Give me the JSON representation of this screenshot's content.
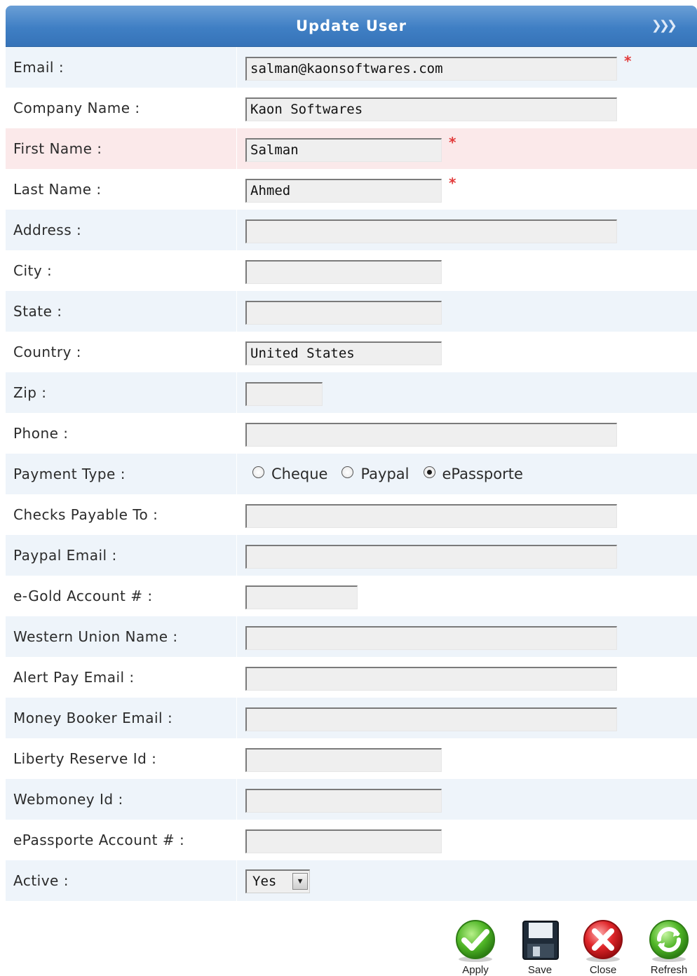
{
  "window": {
    "title": "Update User"
  },
  "fields": [
    {
      "label": "Email :",
      "value": "salman@kaonsoftwares.com",
      "width": "long",
      "required": true
    },
    {
      "label": "Company Name :",
      "value": "Kaon Softwares",
      "width": "long",
      "required": false
    },
    {
      "label": "First Name :",
      "value": "Salman",
      "width": "mid",
      "required": true
    },
    {
      "label": "Last Name :",
      "value": "Ahmed",
      "width": "mid",
      "required": true
    },
    {
      "label": "Address :",
      "value": "",
      "width": "long",
      "required": false
    },
    {
      "label": "City :",
      "value": "",
      "width": "mid",
      "required": false
    },
    {
      "label": "State :",
      "value": "",
      "width": "mid",
      "required": false
    },
    {
      "label": "Country :",
      "value": "United States",
      "width": "mid",
      "required": false
    },
    {
      "label": "Zip :",
      "value": "",
      "width": "w110",
      "required": false
    },
    {
      "label": "Phone :",
      "value": "",
      "width": "long",
      "required": false
    }
  ],
  "payment": {
    "label": "Payment Type :",
    "options": [
      "Cheque",
      "Paypal",
      "ePassporte"
    ],
    "selected": "ePassporte"
  },
  "fields2": [
    {
      "label": "Checks Payable To :",
      "value": "",
      "width": "long"
    },
    {
      "label": "Paypal Email :",
      "value": "",
      "width": "long"
    },
    {
      "label": "e-Gold Account # :",
      "value": "",
      "width": "w160"
    },
    {
      "label": "Western Union Name :",
      "value": "",
      "width": "long"
    },
    {
      "label": "Alert Pay Email :",
      "value": "",
      "width": "long"
    },
    {
      "label": "Money Booker Email :",
      "value": "",
      "width": "long"
    },
    {
      "label": "Liberty Reserve Id :",
      "value": "",
      "width": "mid"
    },
    {
      "label": "Webmoney Id :",
      "value": "",
      "width": "mid"
    },
    {
      "label": "ePassporte Account # :",
      "value": "",
      "width": "mid"
    }
  ],
  "active": {
    "label": "Active :",
    "value": "Yes"
  },
  "required_marker": "*",
  "buttons": [
    {
      "label": "Apply",
      "icon": "check-icon"
    },
    {
      "label": "Save",
      "icon": "floppy-disk-icon"
    },
    {
      "label": "Close",
      "icon": "close-icon"
    },
    {
      "label": "Refresh",
      "icon": "refresh-icon"
    }
  ],
  "colors": {
    "header": "#4a86c8",
    "row_alt": "#eef4fa",
    "error_row": "#fbe9ea",
    "required": "#e23a3a"
  }
}
